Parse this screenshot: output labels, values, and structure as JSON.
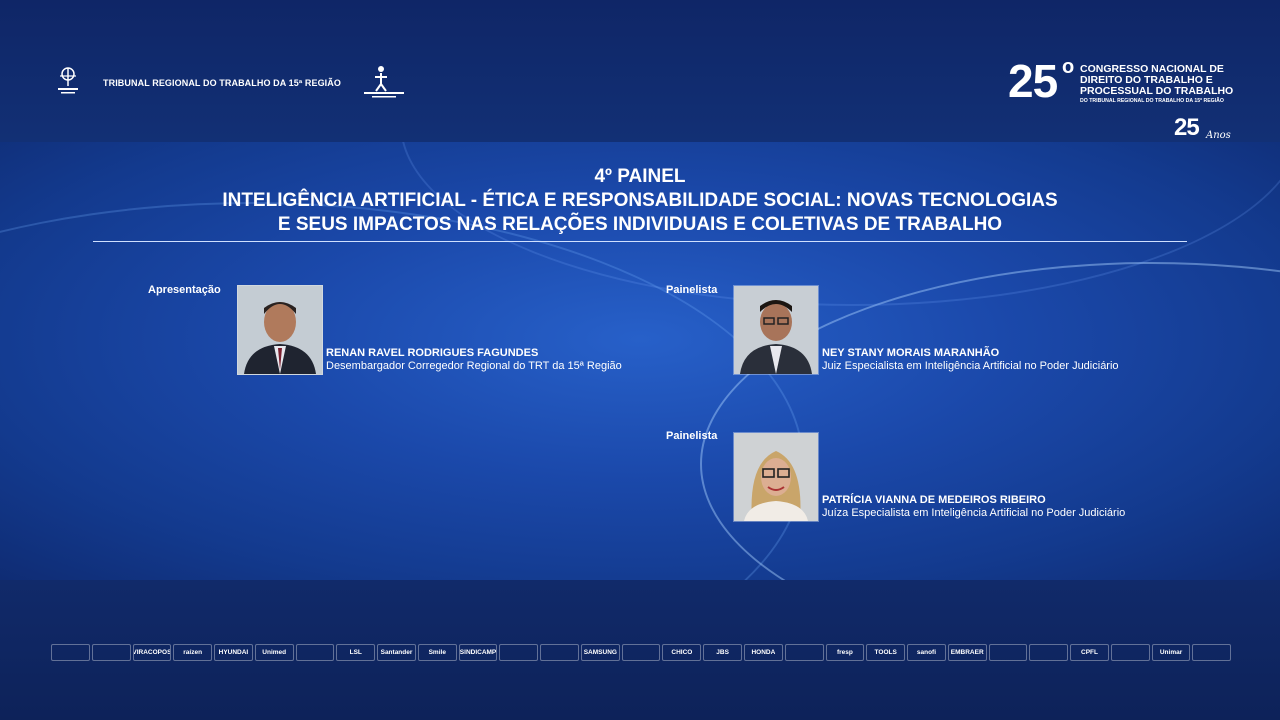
{
  "header": {
    "org_name": "TRIBUNAL REGIONAL DO TRABALHO DA 15ª REGIÃO",
    "logo_left_name": "escola-judicial-logo",
    "logo_right_name": "trt15-logo"
  },
  "congress": {
    "number": "25",
    "degree": "o",
    "line1": "CONGRESSO NACIONAL DE",
    "line2": "DIREITO DO TRABALHO E",
    "line3": "PROCESSUAL DO TRABALHO",
    "subline": "DO TRIBUNAL REGIONAL DO TRABALHO DA 15ª REGIÃO",
    "anniversary_number": "25",
    "anniversary_word": "Anos"
  },
  "panel": {
    "number": "4º PAINEL",
    "title_line1": "INTELIGÊNCIA ARTIFICIAL - ÉTICA E RESPONSABILIDADE SOCIAL: NOVAS TECNOLOGIAS",
    "title_line2": "E SEUS IMPACTOS NAS RELAÇÕES INDIVIDUAIS E COLETIVAS DE TRABALHO"
  },
  "speakers": [
    {
      "role": "Apresentação",
      "name": "RENAN RAVEL RODRIGUES FAGUNDES",
      "title": "Desembargador Corregedor Regional do TRT da 15ª Região"
    },
    {
      "role": "Painelista",
      "name": "NEY STANY MORAIS MARANHÃO",
      "title": "Juiz Especialista em Inteligência Artificial no Poder Judiciário"
    },
    {
      "role": "Painelista",
      "name": "PATRÍCIA VIANNA DE MEDEIROS RIBEIRO",
      "title": "Juíza Especialista em Inteligência Artificial no Poder Judiciário"
    }
  ],
  "sponsors": [
    "",
    "",
    "VIRACOPOS",
    "raízen",
    "HYUNDAI",
    "Unimed",
    "",
    "LSL",
    "Santander",
    "Smile",
    "SINDICAMP",
    "",
    "",
    "SAMSUNG",
    "",
    "CHICO",
    "JBS",
    "HONDA",
    "",
    "fresp",
    "TOOLS",
    "sanofi",
    "EMBRAER",
    "",
    "",
    "CPFL",
    "",
    "Unimar",
    ""
  ]
}
